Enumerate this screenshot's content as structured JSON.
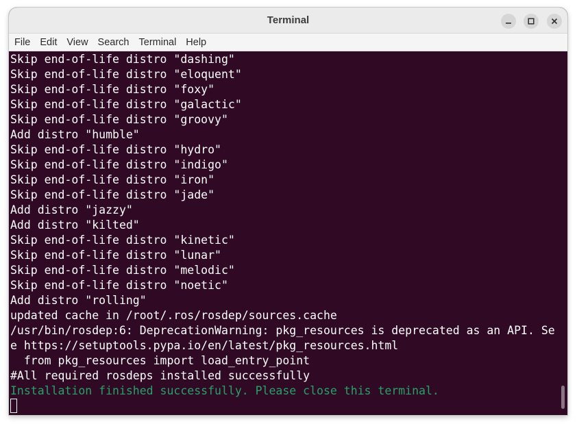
{
  "window": {
    "title": "Terminal"
  },
  "menu": {
    "items": [
      "File",
      "Edit",
      "View",
      "Search",
      "Terminal",
      "Help"
    ]
  },
  "terminal": {
    "colors": {
      "background": "#300a24",
      "text": "#ffffff",
      "success": "#26a269"
    },
    "lines": [
      "Skip end-of-life distro \"dashing\"",
      "Skip end-of-life distro \"eloquent\"",
      "Skip end-of-life distro \"foxy\"",
      "Skip end-of-life distro \"galactic\"",
      "Skip end-of-life distro \"groovy\"",
      "Add distro \"humble\"",
      "Skip end-of-life distro \"hydro\"",
      "Skip end-of-life distro \"indigo\"",
      "Skip end-of-life distro \"iron\"",
      "Skip end-of-life distro \"jade\"",
      "Add distro \"jazzy\"",
      "Add distro \"kilted\"",
      "Skip end-of-life distro \"kinetic\"",
      "Skip end-of-life distro \"lunar\"",
      "Skip end-of-life distro \"melodic\"",
      "Skip end-of-life distro \"noetic\"",
      "Add distro \"rolling\"",
      "updated cache in /root/.ros/rosdep/sources.cache",
      "/usr/bin/rosdep:6: DeprecationWarning: pkg_resources is deprecated as an API. Se",
      "e https://setuptools.pypa.io/en/latest/pkg_resources.html",
      "  from pkg_resources import load_entry_point",
      "#All required rosdeps installed successfully"
    ],
    "final_message": "Installation finished successfully. Please close this terminal."
  }
}
